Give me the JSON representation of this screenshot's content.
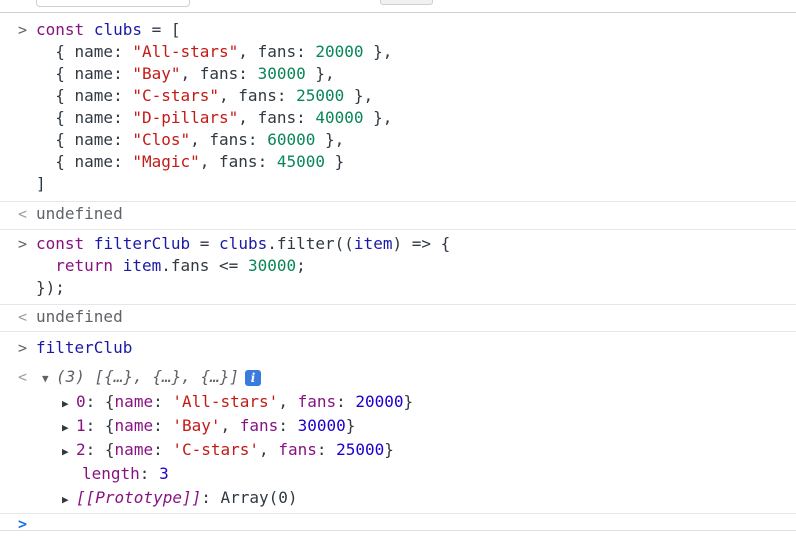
{
  "colors": {
    "keyword": "#881280",
    "string": "#c41a16",
    "number": "#098658",
    "badge": "#3a7be0"
  },
  "icons": {
    "input_prompt": "chevron-right-icon",
    "result_arrow": "chevron-left-icon",
    "expanded": "triangle-down-icon",
    "collapsed": "triangle-right-icon",
    "info": "info-icon"
  },
  "entry1": {
    "l1": {
      "kw": "const",
      "name": "clubs",
      "rest": " = ["
    },
    "rows": [
      {
        "name": "\"All-stars\"",
        "fans": "20000",
        "tail": " },"
      },
      {
        "name": "\"Bay\"",
        "fans": "30000",
        "tail": " },"
      },
      {
        "name": "\"C-stars\"",
        "fans": "25000",
        "tail": " },"
      },
      {
        "name": "\"D-pillars\"",
        "fans": "40000",
        "tail": " },"
      },
      {
        "name": "\"Clos\"",
        "fans": "60000",
        "tail": " },"
      },
      {
        "name": "\"Magic\"",
        "fans": "45000",
        "tail": " }"
      }
    ],
    "close": "]",
    "result": "undefined"
  },
  "entry2": {
    "l1_kw": "const",
    "l1_name": "filterClub",
    "l1_mid": " = ",
    "l1_obj": "clubs",
    "l1_call": ".filter((",
    "l1_param": "item",
    "l1_end": ") => {",
    "l2_kw": "return",
    "l2_obj": "item",
    "l2_prop": ".fans <= ",
    "l2_num": "30000",
    "l2_end": ";",
    "l3": "});",
    "result": "undefined"
  },
  "entry3": {
    "input": "filterClub",
    "summary": "(3) [{…}, {…}, {…}]",
    "badge": "i",
    "items": [
      {
        "index": "0",
        "name": "'All-stars'",
        "fans": "20000"
      },
      {
        "index": "1",
        "name": "'Bay'",
        "fans": "30000"
      },
      {
        "index": "2",
        "name": "'C-stars'",
        "fans": "25000"
      }
    ],
    "length_key": "length",
    "length_val": "3",
    "proto_key": "[[Prototype]]",
    "proto_val": "Array(0)"
  },
  "prompt_symbol": ">",
  "result_symbol": "<"
}
